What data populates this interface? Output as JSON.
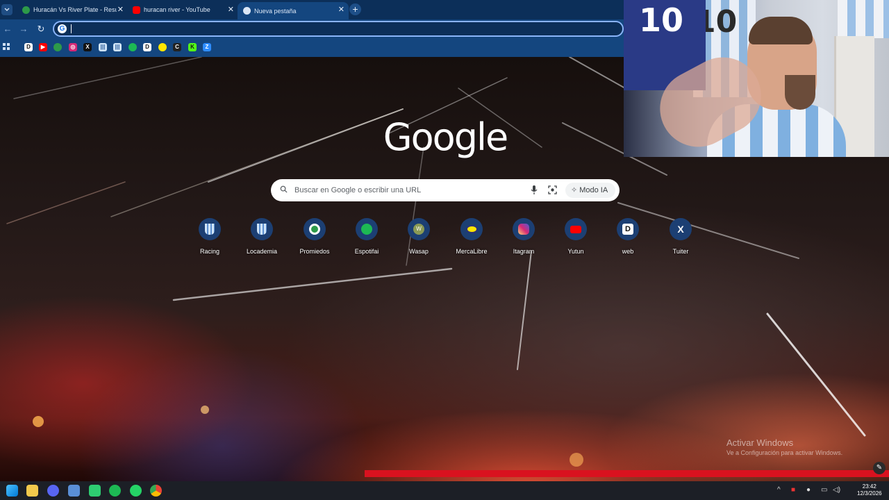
{
  "browser": {
    "tabs": [
      {
        "title": "Huracán Vs River Plate - Resulta",
        "favicon": "soccer-ball-icon",
        "active": false
      },
      {
        "title": "huracan river - YouTube",
        "favicon": "youtube-icon",
        "active": false
      },
      {
        "title": "Nueva pestaña",
        "favicon": "chrome-icon",
        "active": true
      }
    ],
    "omnibox_value": ""
  },
  "bookmarks": [
    "d-icon",
    "youtube-icon",
    "soccer-icon",
    "instagram-icon",
    "x-icon",
    "racing-icon",
    "racing-icon",
    "spotify-icon",
    "d-icon",
    "ml-icon",
    "c-icon",
    "k-icon",
    "z-icon"
  ],
  "ntp": {
    "logo": "Google",
    "search_placeholder": "Buscar en Google o escribir una URL",
    "modo_ia": "Modo IA",
    "shortcuts": [
      {
        "label": "Racing",
        "icon": "racing-icon"
      },
      {
        "label": "Locademia",
        "icon": "racing-icon"
      },
      {
        "label": "Promiedos",
        "icon": "soccer-ball-icon"
      },
      {
        "label": "Espotifai",
        "icon": "spotify-icon"
      },
      {
        "label": "Wasap",
        "icon": "w-icon"
      },
      {
        "label": "MercaLibre",
        "icon": "mercadolibre-icon"
      },
      {
        "label": "Itagram",
        "icon": "instagram-icon"
      },
      {
        "label": "Yutun",
        "icon": "youtube-icon"
      },
      {
        "label": "web",
        "icon": "d-icon"
      },
      {
        "label": "Tuiter",
        "icon": "x-icon"
      }
    ]
  },
  "webcam": {
    "jersey_left": "10",
    "jersey_right": "10"
  },
  "watermark": {
    "title": "Activar Windows",
    "subtitle": "Ve a Configuración para activar Windows."
  },
  "taskbar": {
    "time": "23:42",
    "date": "12/3/2026"
  },
  "colors": {
    "tab_strip": "#0c2f59",
    "toolbar": "#14467f",
    "accent": "#8ab4f8"
  }
}
